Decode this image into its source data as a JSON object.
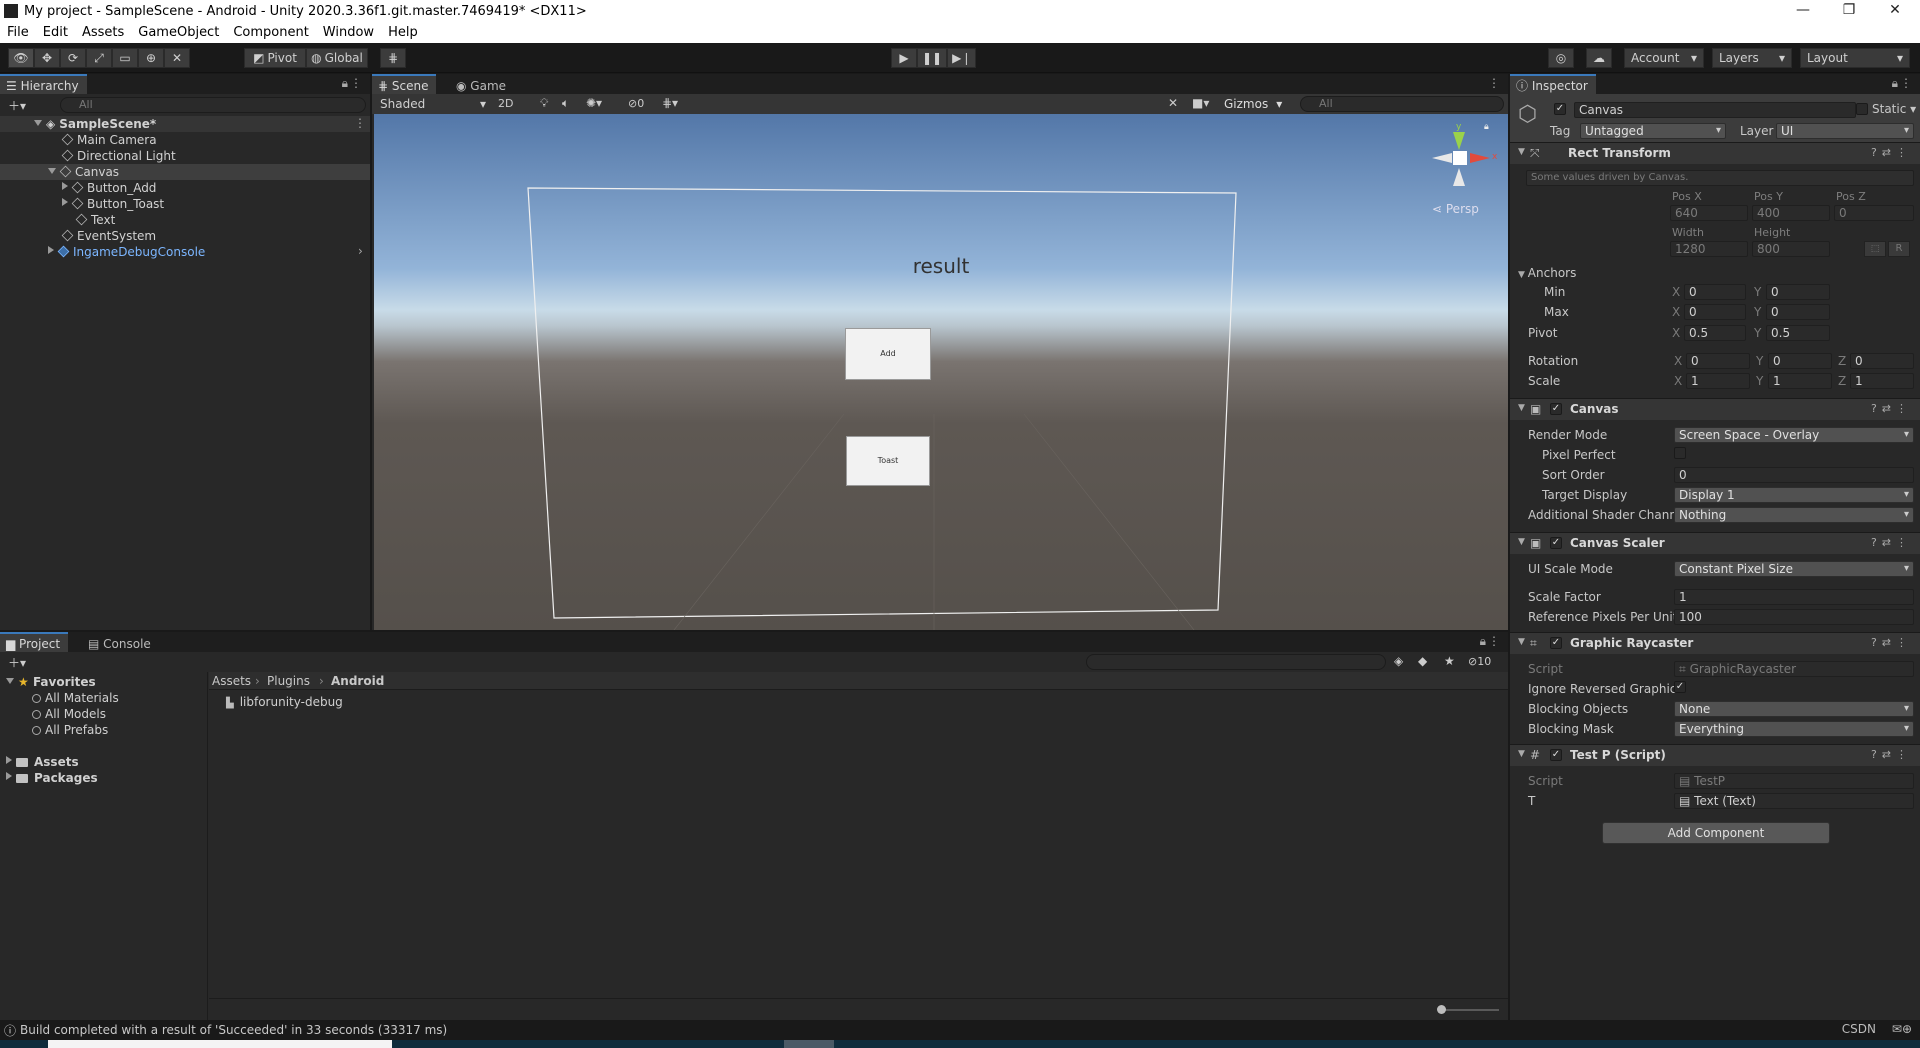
{
  "window": {
    "title": "My project - SampleScene - Android - Unity 2020.3.36f1.git.master.7469419* <DX11>",
    "controls": [
      "—",
      "❐",
      "✕"
    ]
  },
  "menu": [
    "File",
    "Edit",
    "Assets",
    "GameObject",
    "Component",
    "Window",
    "Help"
  ],
  "toolbar": {
    "pivot": "Pivot",
    "global": "Global",
    "account": "Account",
    "layers": "Layers",
    "layout": "Layout"
  },
  "hierarchy": {
    "tab": "Hierarchy",
    "search_placeholder": "All",
    "scene": "SampleScene*",
    "items": [
      "Main Camera",
      "Directional Light",
      "Canvas",
      "Button_Add",
      "Button_Toast",
      "Text",
      "EventSystem",
      "IngameDebugConsole"
    ]
  },
  "scene_view": {
    "tabs": [
      "Scene",
      "Game"
    ],
    "shading": "Shaded",
    "mode_2d": "2D",
    "hidden_count": "0",
    "gizmos": "Gizmos",
    "search_placeholder": "All",
    "persp": "Persp",
    "axis_y": "y",
    "axis_x": "x",
    "canvas_text": "result",
    "button_add": "Add",
    "button_toast": "Toast"
  },
  "inspector": {
    "tab": "Inspector",
    "object_name": "Canvas",
    "static": "Static",
    "tag_label": "Tag",
    "tag": "Untagged",
    "layer_label": "Layer",
    "layer": "UI",
    "rect_transform": {
      "title": "Rect Transform",
      "note": "Some values driven by Canvas.",
      "pos_x_label": "Pos X",
      "pos_y_label": "Pos Y",
      "pos_z_label": "Pos Z",
      "pos_x": "640",
      "pos_y": "400",
      "pos_z": "0",
      "width_label": "Width",
      "height_label": "Height",
      "width": "1280",
      "height": "800",
      "r_button": "R",
      "anchors": "Anchors",
      "min": "Min",
      "max": "Max",
      "min_x": "0",
      "min_y": "0",
      "max_x": "0",
      "max_y": "0",
      "pivot": "Pivot",
      "pivot_x": "0.5",
      "pivot_y": "0.5",
      "rotation": "Rotation",
      "rot_x": "0",
      "rot_y": "0",
      "rot_z": "0",
      "scale": "Scale",
      "scale_x": "1",
      "scale_y": "1",
      "scale_z": "1",
      "axis_x": "X",
      "axis_y": "Y",
      "axis_z": "Z"
    },
    "canvas": {
      "title": "Canvas",
      "render_mode_label": "Render Mode",
      "render_mode": "Screen Space - Overlay",
      "pixel_perfect_label": "Pixel Perfect",
      "sort_order_label": "Sort Order",
      "sort_order": "0",
      "target_display_label": "Target Display",
      "target_display": "Display 1",
      "shader_channels_label": "Additional Shader Channe",
      "shader_channels": "Nothing"
    },
    "canvas_scaler": {
      "title": "Canvas Scaler",
      "ui_scale_mode_label": "UI Scale Mode",
      "ui_scale_mode": "Constant Pixel Size",
      "scale_factor_label": "Scale Factor",
      "scale_factor": "1",
      "ref_ppu_label": "Reference Pixels Per Unit",
      "ref_ppu": "100"
    },
    "graphic_raycaster": {
      "title": "Graphic Raycaster",
      "script_label": "Script",
      "script": "GraphicRaycaster",
      "ignore_reversed_label": "Ignore Reversed Graphics",
      "blocking_objects_label": "Blocking Objects",
      "blocking_objects": "None",
      "blocking_mask_label": "Blocking Mask",
      "blocking_mask": "Everything"
    },
    "test_p": {
      "title": "Test P (Script)",
      "script_label": "Script",
      "script": "TestP",
      "t_label": "T",
      "t_value": "Text (Text)"
    },
    "add_component": "Add Component"
  },
  "project": {
    "tabs": [
      "Project",
      "Console"
    ],
    "favorites": "Favorites",
    "fav_items": [
      "All Materials",
      "All Models",
      "All Prefabs"
    ],
    "roots": [
      "Assets",
      "Packages"
    ],
    "breadcrumb": [
      "Assets",
      "Plugins",
      "Android"
    ],
    "files": [
      "libforunity-debug"
    ],
    "hidden_count": "10"
  },
  "status": {
    "message": "Build completed with a result of 'Succeeded' in 33 seconds (33317 ms)",
    "right": "CSDN"
  },
  "colors": {
    "accent": "#3a79bb",
    "prefab_blue": "#7cb6ff"
  }
}
